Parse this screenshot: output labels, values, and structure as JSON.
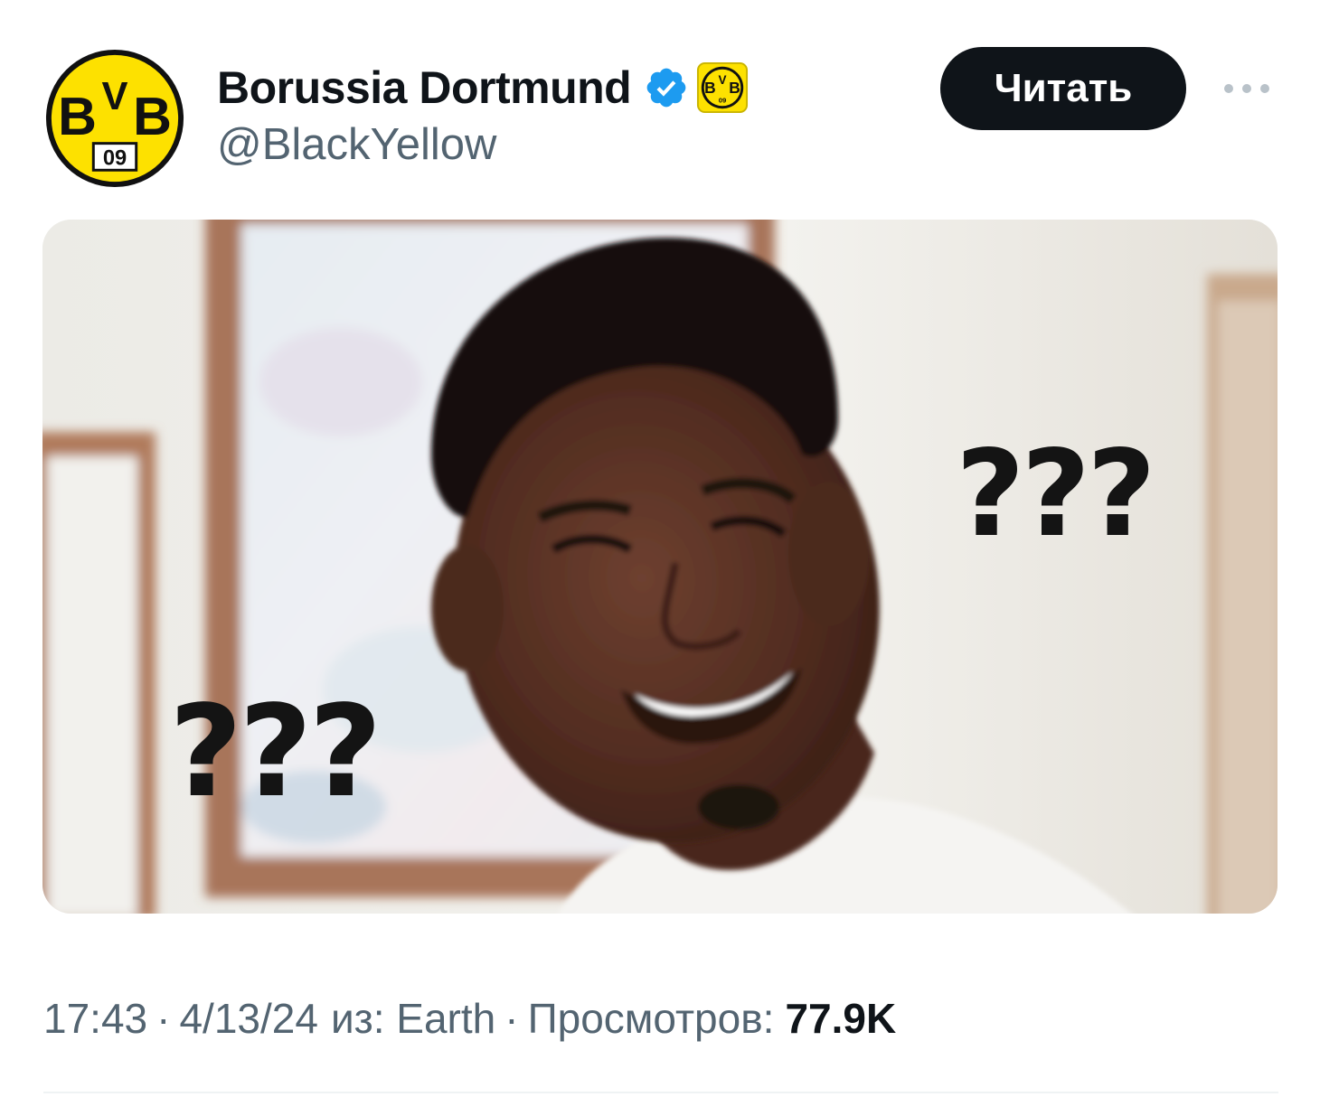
{
  "author": {
    "display_name": "Borussia Dortmund",
    "handle": "@BlackYellow",
    "avatar_text": {
      "top_left": "B",
      "top_mid": "V",
      "top_right": "B",
      "bottom": "09"
    },
    "verified": true,
    "affiliate_badge": "bvb-logo"
  },
  "actions": {
    "follow_label": "Читать",
    "more_icon": "more-horizontal-icon"
  },
  "media": {
    "overlay_text_right": "???",
    "overlay_text_left": "???"
  },
  "meta": {
    "time": "17:43",
    "separator": "·",
    "date": "4/13/24",
    "source": "из: Earth",
    "views_label": "Просмотров:",
    "views_count": "77.9K"
  },
  "colors": {
    "brand_yellow": "#fde100",
    "verified_blue": "#1d9bf0",
    "text_primary": "#0f1419",
    "text_secondary": "#536471",
    "button_bg": "#0f1419"
  }
}
